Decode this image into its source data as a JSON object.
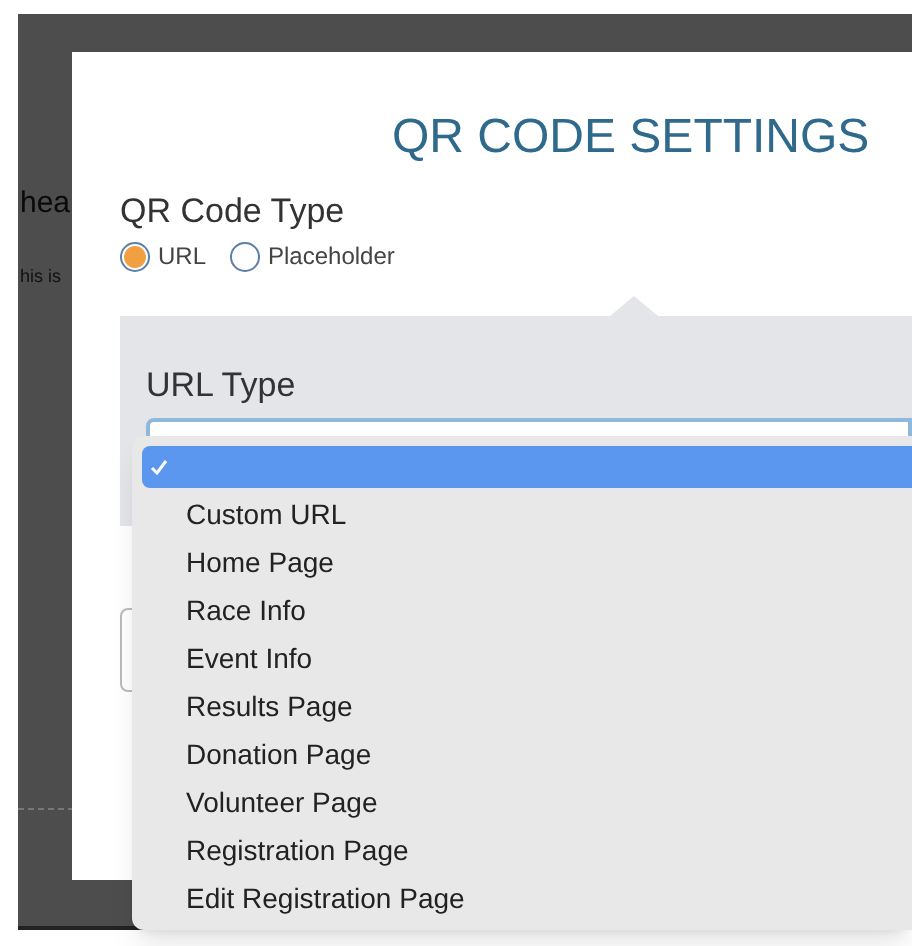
{
  "background_page": {
    "heading": "hea",
    "text": "his is"
  },
  "modal": {
    "title": "QR CODE SETTINGS",
    "qr_code_type": {
      "label": "QR Code Type",
      "options": [
        {
          "label": "URL",
          "selected": true
        },
        {
          "label": "Placeholder",
          "selected": false
        }
      ]
    },
    "url_type": {
      "label": "URL Type"
    }
  },
  "dropdown": {
    "options": [
      {
        "selected": true
      },
      {
        "label": "Custom URL",
        "selected": false
      },
      {
        "label": "Home Page",
        "selected": false
      },
      {
        "label": "Race Info",
        "selected": false
      },
      {
        "label": "Event Info",
        "selected": false
      },
      {
        "label": "Results Page",
        "selected": false
      },
      {
        "label": "Donation Page",
        "selected": false
      },
      {
        "label": "Volunteer Page",
        "selected": false
      },
      {
        "label": "Registration Page",
        "selected": false
      },
      {
        "label": "Edit Registration Page",
        "selected": false
      }
    ]
  }
}
